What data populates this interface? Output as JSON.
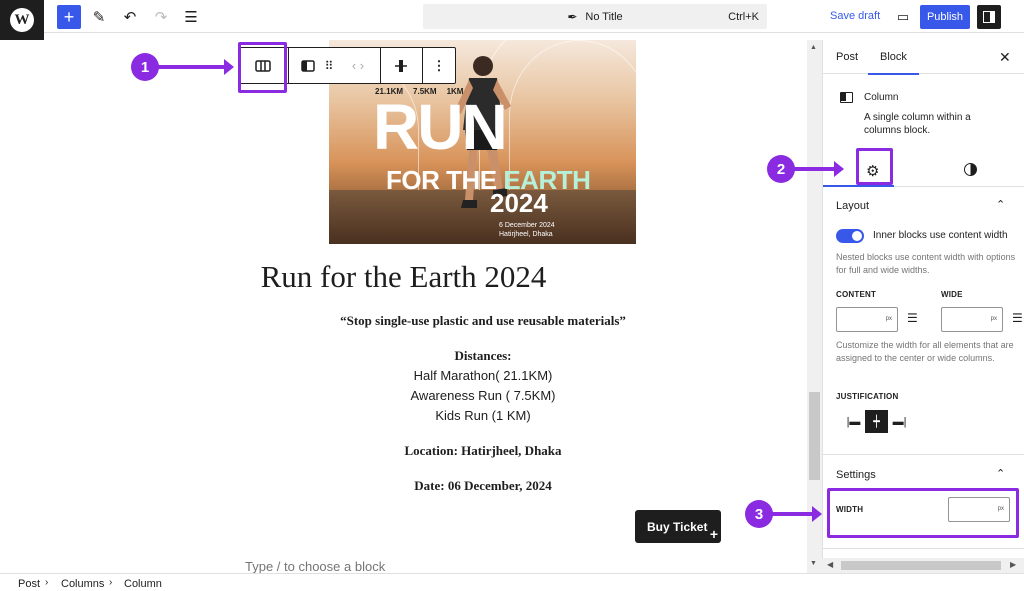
{
  "header": {
    "document_title": "No Title",
    "shortcut": "Ctrl+K",
    "save_draft": "Save draft",
    "publish": "Publish"
  },
  "poster": {
    "distances": [
      "21.1KM",
      "7.5KM",
      "1KM"
    ],
    "run": "RUN",
    "for_the": "FOR THE ",
    "earth": "EARTH",
    "year": "2024",
    "date_line": "6 December 2024",
    "place_line": "Hatirjheel, Dhaka"
  },
  "content": {
    "title": "Run for the Earth 2024",
    "quote": "“Stop single-use plastic and use reusable materials”",
    "distances_heading": "Distances:",
    "distance_items": [
      "Half Marathon( 21.1KM)",
      "Awareness Run ( 7.5KM)",
      "Kids Run (1 KM)"
    ],
    "location": "Location: Hatirjheel, Dhaka",
    "date": "Date: 06 December, 2024",
    "buy_ticket": "Buy Ticket",
    "block_placeholder": "Type / to choose a block"
  },
  "markers": [
    "1",
    "2",
    "3"
  ],
  "sidebar": {
    "tabs": [
      "Post",
      "Block"
    ],
    "active_tab": "Block",
    "block_name": "Column",
    "block_description": "A single column within a columns block.",
    "layout": {
      "title": "Layout",
      "toggle_label": "Inner blocks use content width",
      "toggle_on": true,
      "toggle_help": "Nested blocks use content width with options for full and wide widths.",
      "content_label": "CONTENT",
      "wide_label": "WIDE",
      "unit": "px",
      "width_help": "Customize the width for all elements that are assigned to the center or wide columns.",
      "justification_label": "JUSTIFICATION"
    },
    "settings": {
      "title": "Settings",
      "width_label": "WIDTH",
      "unit": "px"
    }
  },
  "breadcrumb": [
    "Post",
    "Columns",
    "Column"
  ],
  "colors": {
    "accent": "#3858e9",
    "annotation": "#8a2be2",
    "dark": "#1e1e1e"
  }
}
